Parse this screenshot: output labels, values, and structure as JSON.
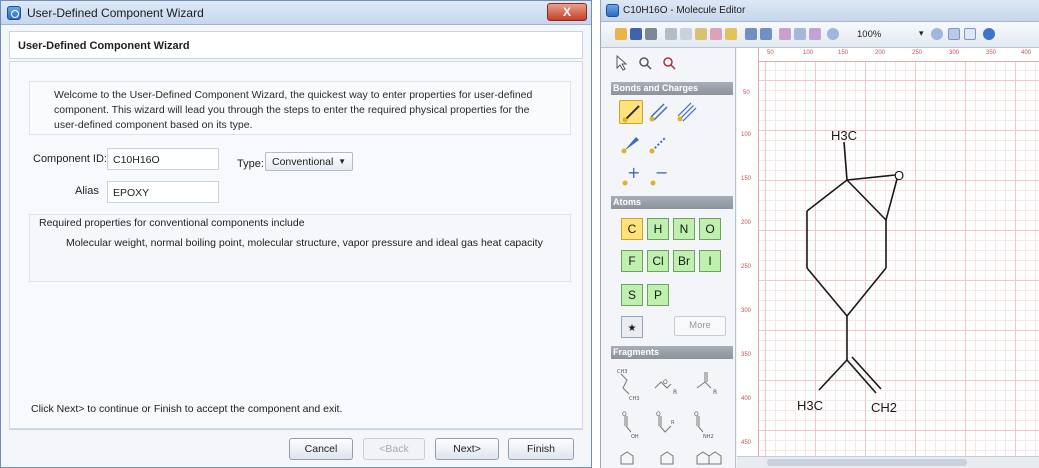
{
  "wizard": {
    "window_title": "User-Defined Component Wizard",
    "close_label": "X",
    "header_title": "User-Defined Component Wizard",
    "welcome_lines": [
      "Welcome to the User-Defined Component Wizard, the quickest way to enter properties for user-defined",
      "component.  This wizard will lead you through the steps to enter the required physical properties for the",
      "user-defined component based on its type."
    ],
    "component_id_label": "Component ID:",
    "component_id_value": "C10H16O",
    "alias_label": "Alias",
    "alias_value": "EPOXY",
    "type_label": "Type:",
    "type_value": "Conventional",
    "props_title": "Required properties for conventional components include",
    "props_text": "Molecular weight, normal boiling point, molecular structure, vapor pressure and ideal gas heat capacity",
    "footer_text": "Click Next> to continue or Finish to accept the component and exit.",
    "buttons": {
      "cancel": "Cancel",
      "back": "<Back",
      "next": "Next>",
      "finish": "Finish"
    }
  },
  "editor": {
    "window_title": "C10H16O - Molecule Editor",
    "zoom": "100%",
    "sections": {
      "bonds": "Bonds and Charges",
      "atoms": "Atoms",
      "fragments": "Fragments"
    },
    "atoms": [
      "C",
      "H",
      "N",
      "O",
      "F",
      "Cl",
      "Br",
      "I",
      "S",
      "P"
    ],
    "more_label": "More",
    "ruler_x": [
      "50",
      "100",
      "150",
      "200",
      "250",
      "300",
      "350",
      "400"
    ],
    "ruler_y": [
      "50",
      "100",
      "150",
      "200",
      "250",
      "300",
      "350",
      "400",
      "450"
    ],
    "molecule_labels": {
      "top_methyl": "H3C",
      "oxygen": "O",
      "left_methyl": "H3C",
      "right_methylene": "CH2"
    },
    "frag_labels": {
      "ch3": "CH3",
      "r": "R",
      "oh": "OH",
      "nh2": "NH2"
    },
    "colors": {
      "selected_tool": "#ffe37a",
      "atom_bg": "#bff0b0",
      "grid": "#f2c9c9"
    }
  }
}
